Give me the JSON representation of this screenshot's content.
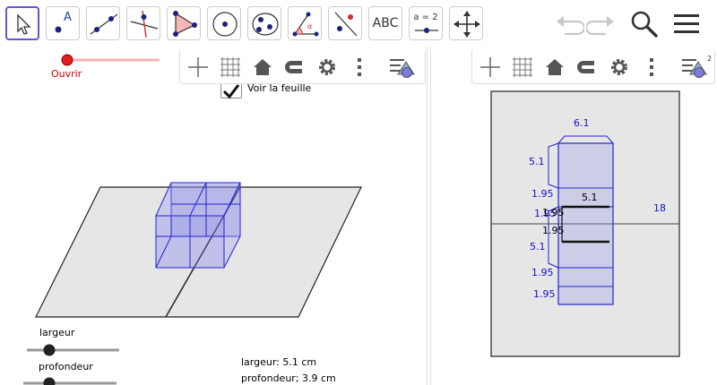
{
  "toolbar": {
    "tools": [
      "move-tool",
      "point-tool",
      "line-tool",
      "perpendicular-line-tool",
      "polygon-tool",
      "circle-center-tool",
      "conic-tool",
      "angle-tool",
      "reflect-tool",
      "text-tool",
      "slider-tool",
      "move-graphics-view-tool"
    ],
    "text_tool_label": "ABC",
    "slider_tool_label": "a = 2",
    "point_tool_label": "A",
    "angle_tool_label": "α"
  },
  "left_panel": {
    "open_slider_label": "Ouvrir",
    "show_sheet_label": "Voir la feuille",
    "show_sheet_checked": true,
    "slider_largeur_label": "largeur",
    "slider_profondeur_label": "profondeur",
    "info_largeur": "largeur: 5.1 cm",
    "info_profondeur": "profondeur; 3.9 cm"
  },
  "right_panel": {
    "labels": {
      "top_width": "6.1",
      "side_top": "5.1",
      "fold1": "1.95",
      "inner_width": "5.1",
      "fold2_a": "1.95",
      "fold2_b": "1.95",
      "right_side": "18",
      "side_mid": "5.1",
      "fold3": "1.95",
      "fold4": "1.95"
    },
    "view_label": "2"
  },
  "colors": {
    "accent": "#6557d2",
    "blue": "#1212c8",
    "slider_red": "#e02020",
    "plane_fill": "#e6e6e6"
  }
}
